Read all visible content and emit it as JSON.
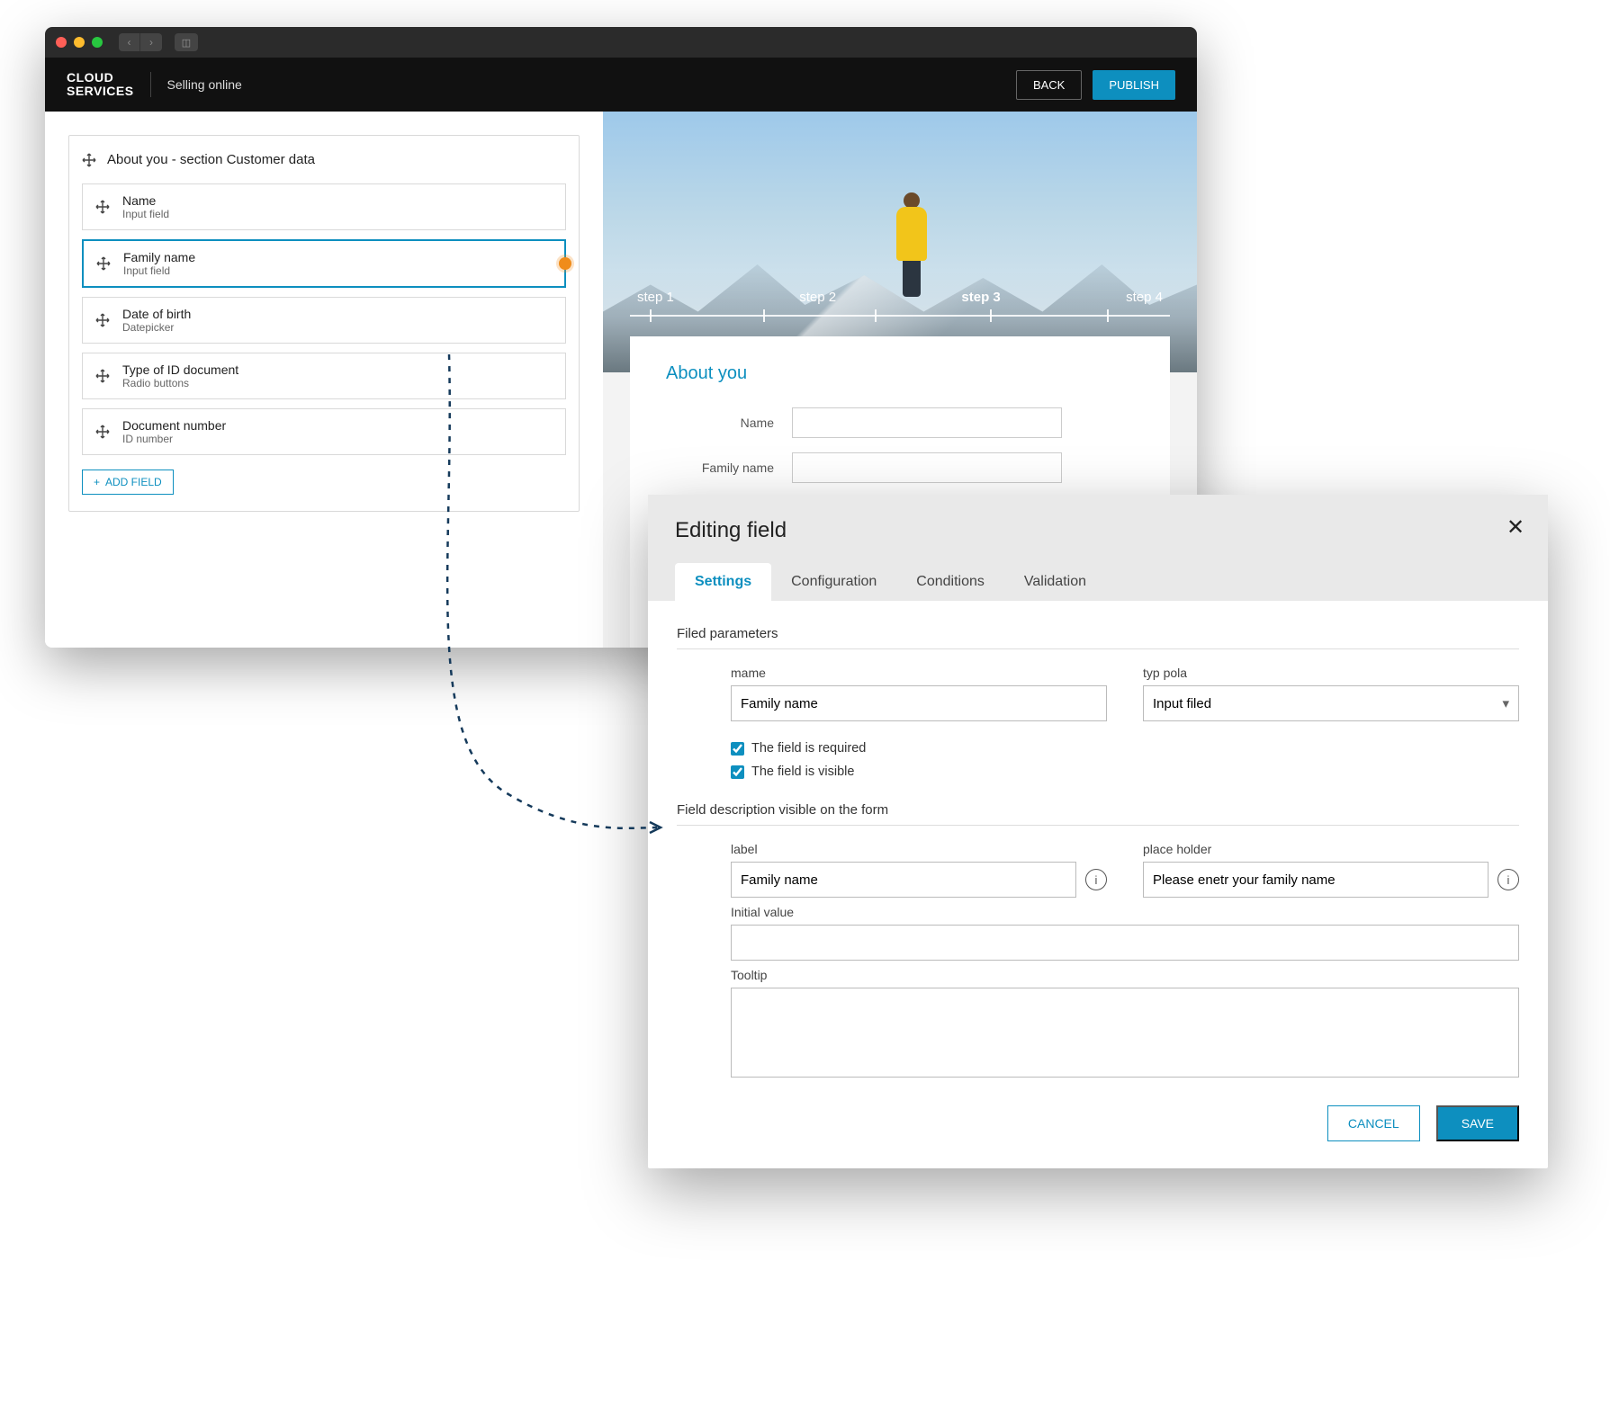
{
  "brand": {
    "line1": "CLOUD",
    "line2": "SERVICES",
    "context": "Selling online"
  },
  "header": {
    "back": "BACK",
    "publish": "PUBLISH"
  },
  "builder": {
    "section_title": "About you - section Customer data",
    "add_field": "ADD FIELD",
    "fields": [
      {
        "title": "Name",
        "subtitle": "Input field"
      },
      {
        "title": "Family name",
        "subtitle": "Input field"
      },
      {
        "title": "Date of birth",
        "subtitle": "Datepicker"
      },
      {
        "title": "Type of ID document",
        "subtitle": "Radio buttons"
      },
      {
        "title": "Document number",
        "subtitle": "ID number"
      }
    ]
  },
  "preview": {
    "steps": [
      "step 1",
      "step 2",
      "step 3",
      "step 4"
    ],
    "active_step_index": 2,
    "form_title": "About you",
    "labels": {
      "name": "Name",
      "family_name": "Family name"
    }
  },
  "modal": {
    "title": "Editing field",
    "tabs": [
      "Settings",
      "Configuration",
      "Conditions",
      "Validation"
    ],
    "active_tab_index": 0,
    "group1": "Filed parameters",
    "name_label": "mame",
    "name_value": "Family name",
    "type_label": "typ pola",
    "type_value": "Input filed",
    "cb_required": "The field is required",
    "cb_visible": "The field is visible",
    "group2": "Field description visible on the form",
    "label_label": "label",
    "label_value": "Family name",
    "placeholder_label": "place holder",
    "placeholder_value": "Please enetr your family name",
    "initial_label": "Initial value",
    "tooltip_label": "Tooltip",
    "cancel": "CANCEL",
    "save": "SAVE"
  }
}
